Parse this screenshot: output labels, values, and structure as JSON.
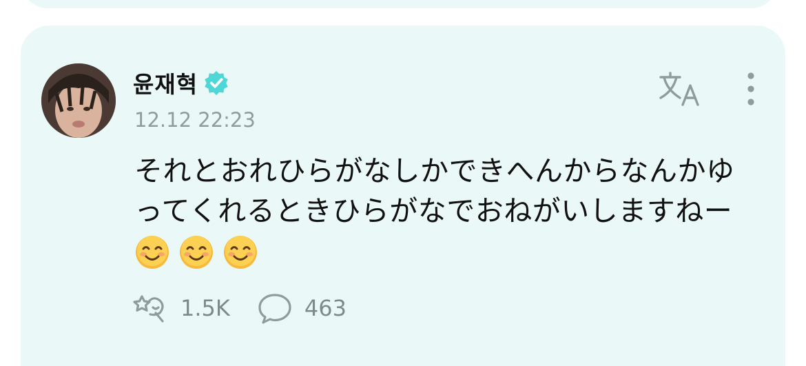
{
  "post": {
    "author": "윤재혁",
    "timestamp": "12.12 22:23",
    "text": "それとおれひらがなしかできへんからなんかゆってくれるときひらがなでおねがいしますねー",
    "emojis": [
      "😊",
      "😊",
      "😊"
    ],
    "reactions_count": "1.5K",
    "comments_count": "463"
  },
  "icons": {
    "verified": "verified-badge-icon",
    "translate": "translate-icon",
    "more": "more-vertical-icon",
    "reaction": "reaction-icon",
    "comment": "comment-bubble-icon"
  },
  "colors": {
    "card_background": "#eaf9f7",
    "verified_badge": "#4fd6d6",
    "icon_gray": "#8f9c9b",
    "text_primary": "#111111"
  }
}
